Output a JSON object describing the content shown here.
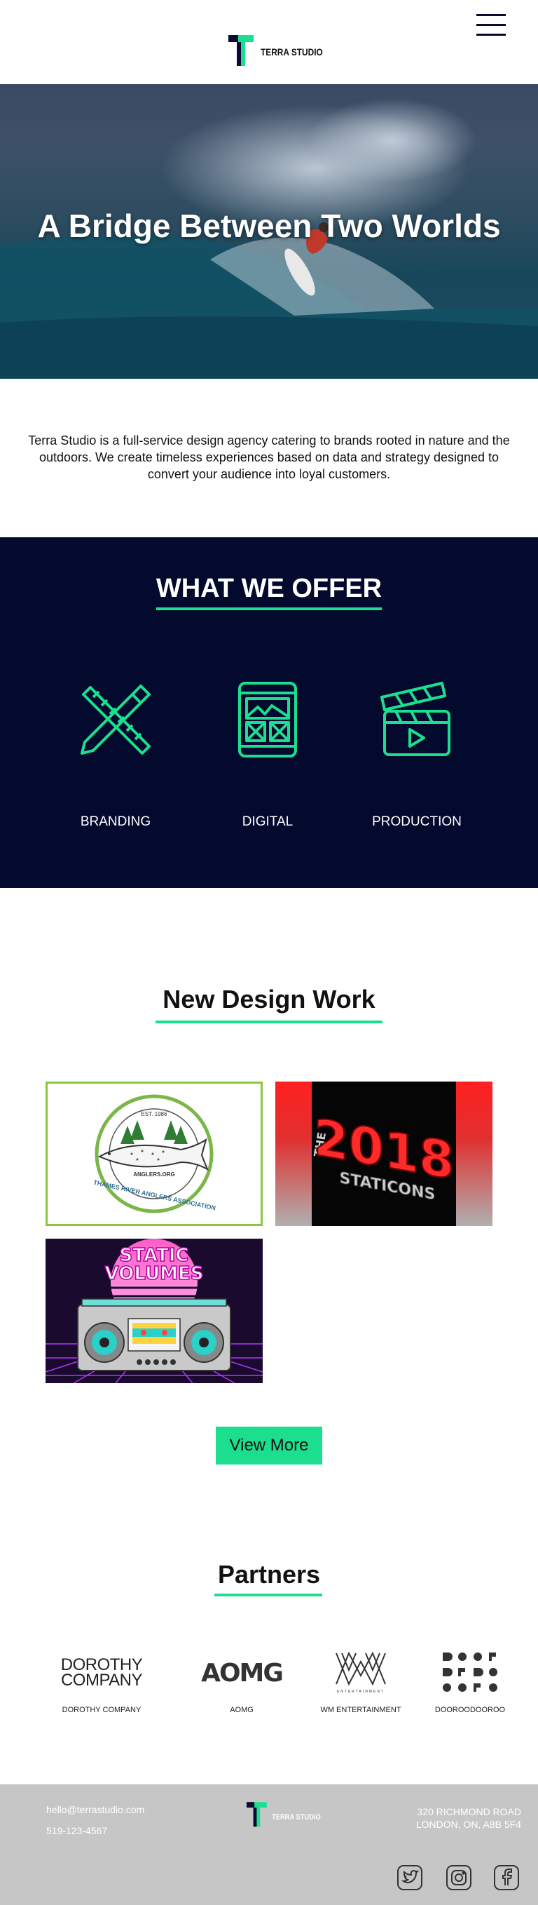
{
  "header": {
    "logo_text": "TERRA STUDIO"
  },
  "hero": {
    "title": "A Bridge Between Two Worlds"
  },
  "intro": {
    "text": "Terra Studio is a full-service design agency catering to brands rooted in nature and the outdoors. We create timeless experiences based on data and strategy designed to convert your audience into loyal customers."
  },
  "offer": {
    "title": "WHAT WE OFFER",
    "services": [
      {
        "label": "BRANDING",
        "icon": "ruler-pencil-icon"
      },
      {
        "label": "DIGITAL",
        "icon": "wireframe-tablet-icon"
      },
      {
        "label": "PRODUCTION",
        "icon": "clapperboard-icon"
      }
    ]
  },
  "work": {
    "title": "New Design Work",
    "items": [
      {
        "name": "thames-river-anglers",
        "est": "EST. 1986",
        "site": "ANGLERS.ORG",
        "arc": "THAMES RIVER ANGLERS ASSOCIATION"
      },
      {
        "name": "the-2018-staticons",
        "pre": "THE",
        "big": "2018",
        "sub": "STATICONS"
      },
      {
        "name": "static-volumes",
        "line1": "STATIC",
        "line2": "VOLUMES"
      }
    ],
    "view_more": "View More"
  },
  "partners": {
    "title": "Partners",
    "items": [
      {
        "label": "DOROTHY COMPANY",
        "logo_line1": "DOROTHY",
        "logo_line2": "COMPANY"
      },
      {
        "label": "AOMG",
        "logo": "AOMG"
      },
      {
        "label": "WM ENTERTAINMENT",
        "logo_sub": "ENTERTAINMENT"
      },
      {
        "label": "DOOROODOOROO"
      }
    ]
  },
  "footer": {
    "email": "hello@terrastudio.com",
    "phone": "519-123-4567",
    "logo_text": "TERRA STUDIO",
    "address_line1": "320 RICHMOND ROAD",
    "address_line2": "LONDON, ON, A8B 5F4",
    "social": [
      "twitter-icon",
      "instagram-icon",
      "facebook-icon"
    ]
  },
  "colors": {
    "accent": "#1bdf8e",
    "navy": "#04092e",
    "footer_bg": "#c6c6c6"
  }
}
